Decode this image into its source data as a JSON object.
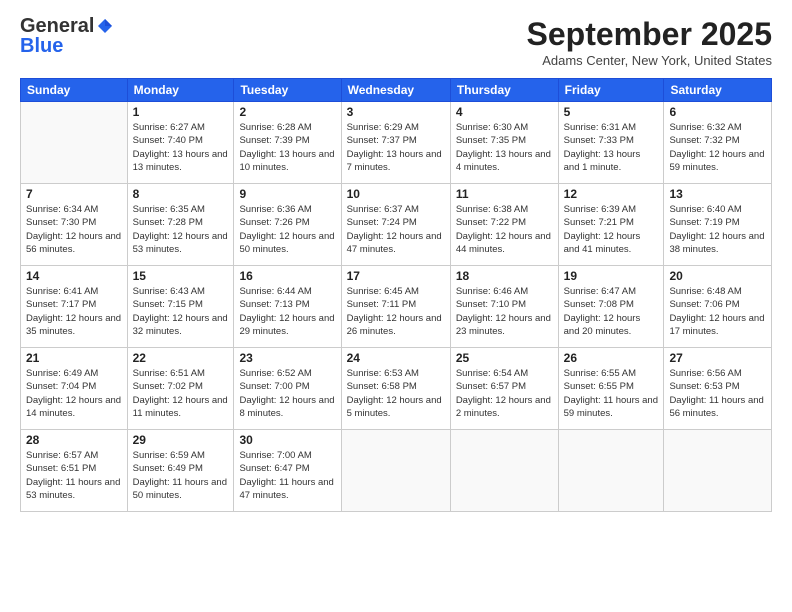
{
  "header": {
    "logo_general": "General",
    "logo_blue": "Blue",
    "month_title": "September 2025",
    "location": "Adams Center, New York, United States"
  },
  "days_of_week": [
    "Sunday",
    "Monday",
    "Tuesday",
    "Wednesday",
    "Thursday",
    "Friday",
    "Saturday"
  ],
  "weeks": [
    [
      {
        "day": "",
        "sunrise": "",
        "sunset": "",
        "daylight": ""
      },
      {
        "day": "1",
        "sunrise": "Sunrise: 6:27 AM",
        "sunset": "Sunset: 7:40 PM",
        "daylight": "Daylight: 13 hours and 13 minutes."
      },
      {
        "day": "2",
        "sunrise": "Sunrise: 6:28 AM",
        "sunset": "Sunset: 7:39 PM",
        "daylight": "Daylight: 13 hours and 10 minutes."
      },
      {
        "day": "3",
        "sunrise": "Sunrise: 6:29 AM",
        "sunset": "Sunset: 7:37 PM",
        "daylight": "Daylight: 13 hours and 7 minutes."
      },
      {
        "day": "4",
        "sunrise": "Sunrise: 6:30 AM",
        "sunset": "Sunset: 7:35 PM",
        "daylight": "Daylight: 13 hours and 4 minutes."
      },
      {
        "day": "5",
        "sunrise": "Sunrise: 6:31 AM",
        "sunset": "Sunset: 7:33 PM",
        "daylight": "Daylight: 13 hours and 1 minute."
      },
      {
        "day": "6",
        "sunrise": "Sunrise: 6:32 AM",
        "sunset": "Sunset: 7:32 PM",
        "daylight": "Daylight: 12 hours and 59 minutes."
      }
    ],
    [
      {
        "day": "7",
        "sunrise": "Sunrise: 6:34 AM",
        "sunset": "Sunset: 7:30 PM",
        "daylight": "Daylight: 12 hours and 56 minutes."
      },
      {
        "day": "8",
        "sunrise": "Sunrise: 6:35 AM",
        "sunset": "Sunset: 7:28 PM",
        "daylight": "Daylight: 12 hours and 53 minutes."
      },
      {
        "day": "9",
        "sunrise": "Sunrise: 6:36 AM",
        "sunset": "Sunset: 7:26 PM",
        "daylight": "Daylight: 12 hours and 50 minutes."
      },
      {
        "day": "10",
        "sunrise": "Sunrise: 6:37 AM",
        "sunset": "Sunset: 7:24 PM",
        "daylight": "Daylight: 12 hours and 47 minutes."
      },
      {
        "day": "11",
        "sunrise": "Sunrise: 6:38 AM",
        "sunset": "Sunset: 7:22 PM",
        "daylight": "Daylight: 12 hours and 44 minutes."
      },
      {
        "day": "12",
        "sunrise": "Sunrise: 6:39 AM",
        "sunset": "Sunset: 7:21 PM",
        "daylight": "Daylight: 12 hours and 41 minutes."
      },
      {
        "day": "13",
        "sunrise": "Sunrise: 6:40 AM",
        "sunset": "Sunset: 7:19 PM",
        "daylight": "Daylight: 12 hours and 38 minutes."
      }
    ],
    [
      {
        "day": "14",
        "sunrise": "Sunrise: 6:41 AM",
        "sunset": "Sunset: 7:17 PM",
        "daylight": "Daylight: 12 hours and 35 minutes."
      },
      {
        "day": "15",
        "sunrise": "Sunrise: 6:43 AM",
        "sunset": "Sunset: 7:15 PM",
        "daylight": "Daylight: 12 hours and 32 minutes."
      },
      {
        "day": "16",
        "sunrise": "Sunrise: 6:44 AM",
        "sunset": "Sunset: 7:13 PM",
        "daylight": "Daylight: 12 hours and 29 minutes."
      },
      {
        "day": "17",
        "sunrise": "Sunrise: 6:45 AM",
        "sunset": "Sunset: 7:11 PM",
        "daylight": "Daylight: 12 hours and 26 minutes."
      },
      {
        "day": "18",
        "sunrise": "Sunrise: 6:46 AM",
        "sunset": "Sunset: 7:10 PM",
        "daylight": "Daylight: 12 hours and 23 minutes."
      },
      {
        "day": "19",
        "sunrise": "Sunrise: 6:47 AM",
        "sunset": "Sunset: 7:08 PM",
        "daylight": "Daylight: 12 hours and 20 minutes."
      },
      {
        "day": "20",
        "sunrise": "Sunrise: 6:48 AM",
        "sunset": "Sunset: 7:06 PM",
        "daylight": "Daylight: 12 hours and 17 minutes."
      }
    ],
    [
      {
        "day": "21",
        "sunrise": "Sunrise: 6:49 AM",
        "sunset": "Sunset: 7:04 PM",
        "daylight": "Daylight: 12 hours and 14 minutes."
      },
      {
        "day": "22",
        "sunrise": "Sunrise: 6:51 AM",
        "sunset": "Sunset: 7:02 PM",
        "daylight": "Daylight: 12 hours and 11 minutes."
      },
      {
        "day": "23",
        "sunrise": "Sunrise: 6:52 AM",
        "sunset": "Sunset: 7:00 PM",
        "daylight": "Daylight: 12 hours and 8 minutes."
      },
      {
        "day": "24",
        "sunrise": "Sunrise: 6:53 AM",
        "sunset": "Sunset: 6:58 PM",
        "daylight": "Daylight: 12 hours and 5 minutes."
      },
      {
        "day": "25",
        "sunrise": "Sunrise: 6:54 AM",
        "sunset": "Sunset: 6:57 PM",
        "daylight": "Daylight: 12 hours and 2 minutes."
      },
      {
        "day": "26",
        "sunrise": "Sunrise: 6:55 AM",
        "sunset": "Sunset: 6:55 PM",
        "daylight": "Daylight: 11 hours and 59 minutes."
      },
      {
        "day": "27",
        "sunrise": "Sunrise: 6:56 AM",
        "sunset": "Sunset: 6:53 PM",
        "daylight": "Daylight: 11 hours and 56 minutes."
      }
    ],
    [
      {
        "day": "28",
        "sunrise": "Sunrise: 6:57 AM",
        "sunset": "Sunset: 6:51 PM",
        "daylight": "Daylight: 11 hours and 53 minutes."
      },
      {
        "day": "29",
        "sunrise": "Sunrise: 6:59 AM",
        "sunset": "Sunset: 6:49 PM",
        "daylight": "Daylight: 11 hours and 50 minutes."
      },
      {
        "day": "30",
        "sunrise": "Sunrise: 7:00 AM",
        "sunset": "Sunset: 6:47 PM",
        "daylight": "Daylight: 11 hours and 47 minutes."
      },
      {
        "day": "",
        "sunrise": "",
        "sunset": "",
        "daylight": ""
      },
      {
        "day": "",
        "sunrise": "",
        "sunset": "",
        "daylight": ""
      },
      {
        "day": "",
        "sunrise": "",
        "sunset": "",
        "daylight": ""
      },
      {
        "day": "",
        "sunrise": "",
        "sunset": "",
        "daylight": ""
      }
    ]
  ]
}
